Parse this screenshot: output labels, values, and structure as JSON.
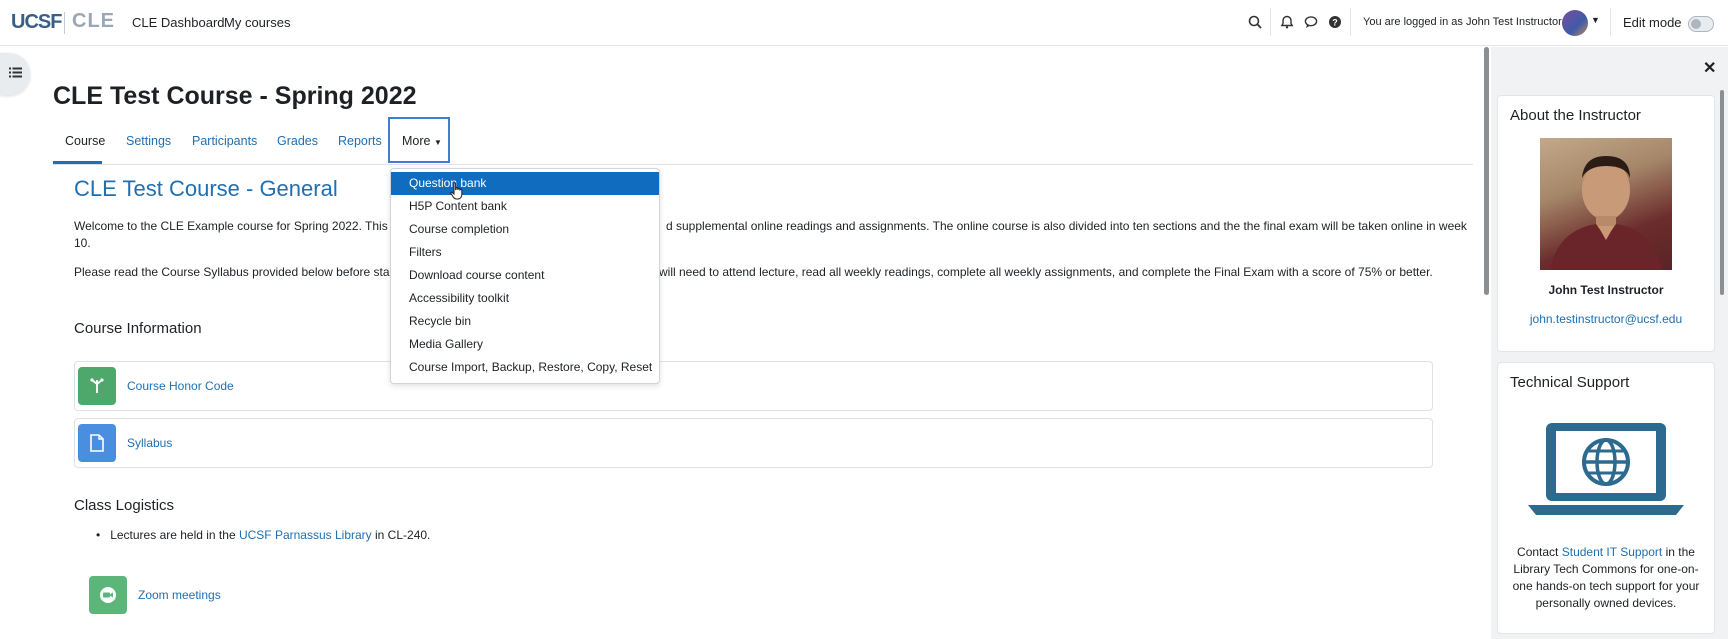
{
  "header": {
    "logo_ucsf": "UCSF",
    "logo_cle": "CLE",
    "nav": [
      "CLE Dashboard",
      "My courses"
    ],
    "logged_in_text": "You are logged in as John Test Instructor",
    "edit_mode_label": "Edit mode",
    "icons": [
      "search-icon",
      "bell-icon",
      "chat-icon",
      "help-icon"
    ]
  },
  "course": {
    "title": "CLE Test Course - Spring 2022",
    "tabs": [
      "Course",
      "Settings",
      "Participants",
      "Grades",
      "Reports",
      "More"
    ],
    "active_tab": "Course"
  },
  "more_menu": {
    "items": [
      "Question bank",
      "H5P Content bank",
      "Course completion",
      "Filters",
      "Download course content",
      "Accessibility toolkit",
      "Recycle bin",
      "Media Gallery",
      "Course Import, Backup, Restore, Copy, Reset"
    ],
    "selected": "Question bank"
  },
  "main": {
    "section_title": "CLE Test Course - General",
    "welcome_a": "Welcome to the CLE Example course for Spring 2022. This is a",
    "welcome_b": "d supplemental online readings and assignments. The online course is also divided into ten sections and the the final exam will be taken online in week",
    "welcome_c": "10.",
    "please_a": "Please read the Course Syllabus provided below before startin",
    "please_b": "will need to attend lecture, read all weekly readings, complete all weekly assignments, and complete the Final Exam with a score of 75% or better.",
    "course_info_heading": "Course Information",
    "activities": [
      {
        "label": "Course Honor Code",
        "icon": "tree-icon",
        "color": "#4fa86b"
      },
      {
        "label": "Syllabus",
        "icon": "document-icon",
        "color": "#4a8ee0"
      }
    ],
    "logistics_heading": "Class Logistics",
    "logistics_pre": "Lectures are held in the ",
    "logistics_link": "UCSF Parnassus Library",
    "logistics_post": " in CL-240.",
    "zoom_label": "Zoom meetings"
  },
  "right": {
    "about_title": "About the Instructor",
    "instructor_name": "John Test Instructor",
    "instructor_email": "john.testinstructor@ucsf.edu",
    "tech_title": "Technical Support",
    "contact_pre": "Contact ",
    "contact_link": "Student IT Support",
    "contact_post": " in the Library Tech Commons for one-on-one hands-on tech support for your personally owned devices."
  }
}
